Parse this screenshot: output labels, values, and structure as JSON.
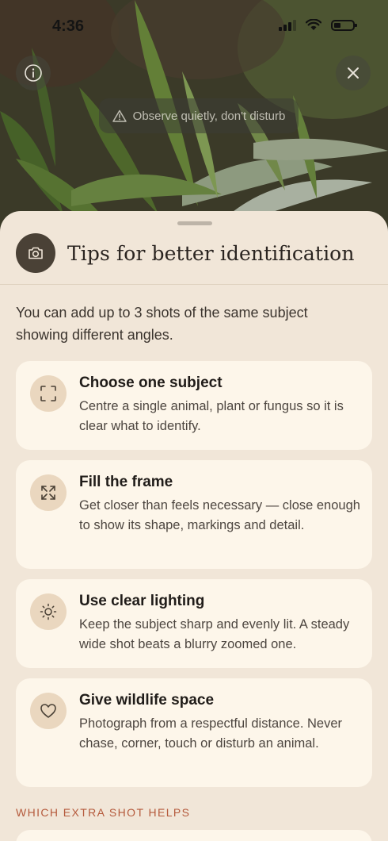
{
  "status_bar": {
    "time": "4:36"
  },
  "camera": {
    "observe_notice": "Observe quietly, don't disturb",
    "info_icon": "info-icon",
    "close_icon": "close-icon"
  },
  "sheet": {
    "title": "Tips for better identification",
    "header_icon": "camera-icon",
    "intro": "You can add up to 3 shots of the same subject showing different angles.",
    "tips": [
      {
        "icon": "focus-frame-icon",
        "title": "Choose one subject",
        "text": "Centre a single animal, plant or fungus so it is clear what to identify."
      },
      {
        "icon": "expand-icon",
        "title": "Fill the frame",
        "text": "Get closer than feels necessary — close enough to show its shape, markings and detail."
      },
      {
        "icon": "sun-icon",
        "title": "Use clear lighting",
        "text": "Keep the subject sharp and evenly lit. A steady wide shot beats a blurry zoomed one."
      },
      {
        "icon": "heart-icon",
        "title": "Give wildlife space",
        "text": "Photograph from a respectful distance. Never chase, corner, touch or disturb an animal."
      }
    ],
    "section_label": "WHICH EXTRA SHOT HELPS"
  },
  "colors": {
    "sheet_bg": "#f1e6d8",
    "card_bg": "#fdf6ea",
    "icon_circle": "#ead7bf",
    "accent_label": "#b55a3c",
    "header_icon_bg": "#4a4136"
  }
}
